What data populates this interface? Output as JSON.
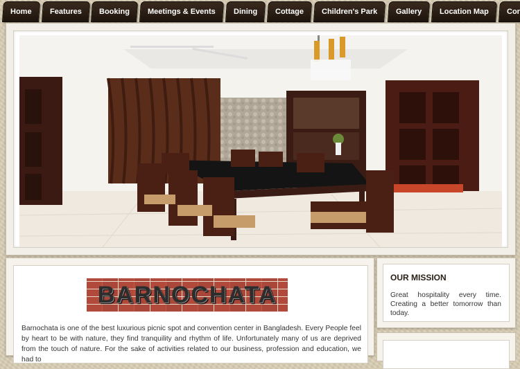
{
  "nav": {
    "items": [
      {
        "label": "Home"
      },
      {
        "label": "Features"
      },
      {
        "label": "Booking"
      },
      {
        "label": "Meetings & Events"
      },
      {
        "label": "Dining"
      },
      {
        "label": "Cottage"
      },
      {
        "label": "Children's Park"
      },
      {
        "label": "Gallery"
      },
      {
        "label": "Location Map"
      },
      {
        "label": "Contact"
      }
    ]
  },
  "about": {
    "logo_text": "BARNOCHATA",
    "text": "Barnochata is one of the best luxurious picnic spot and convention center in Bangladesh.  Every People feel by heart to be with nature, they find tranquility and rhythm of life. Unfortunately many of us are deprived from the touch of nature. For the sake of activities related to our business, profession and education, we had to"
  },
  "mission": {
    "title": "OUR MISSION",
    "text": "Great hospitality every time. Creating a better tomorrow than today."
  },
  "colors": {
    "nav_bg": "#2a1d14",
    "brick": "#b54b3c",
    "page_bg": "#d8cdb4"
  }
}
